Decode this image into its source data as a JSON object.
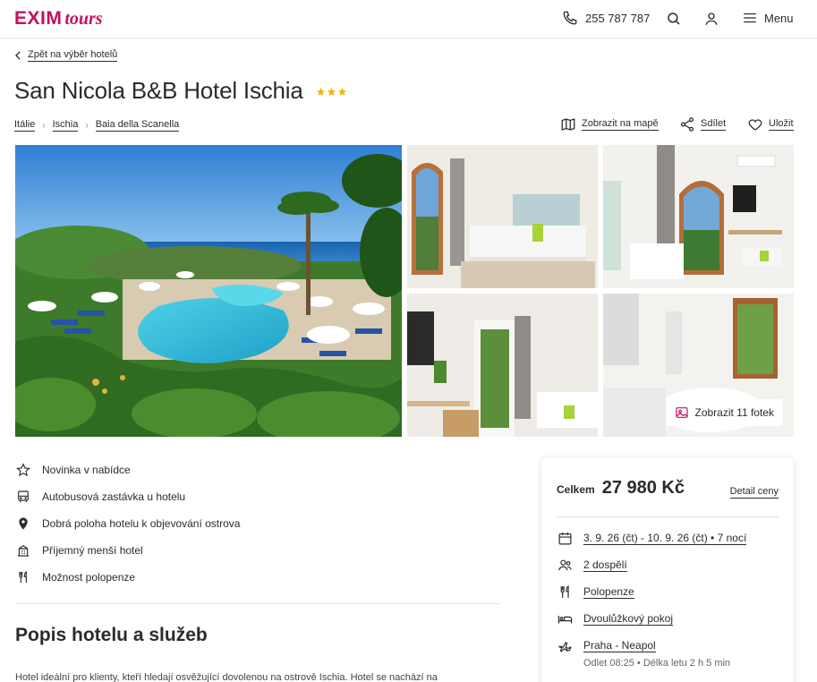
{
  "header": {
    "logo_main": "EXIM",
    "logo_italic": "tours",
    "phone": "255 787 787",
    "menu_label": "Menu"
  },
  "back_link": "Zpět na výběr hotelů",
  "hotel": {
    "name": "San Nicola B&B Hotel Ischia",
    "stars": 3
  },
  "breadcrumbs": [
    "Itálie",
    "Ischia",
    "Baia della Scanella"
  ],
  "actions": {
    "map": "Zobrazit na mapě",
    "share": "Sdílet",
    "save": "Uložit"
  },
  "gallery": {
    "more_label": "Zobrazit 11 fotek"
  },
  "features": [
    {
      "icon": "star-icon",
      "label": "Novinka v nabídce"
    },
    {
      "icon": "bus-icon",
      "label": "Autobusová zastávka u hotelu"
    },
    {
      "icon": "location-pin-icon",
      "label": "Dobrá poloha hotelu k objevování ostrova"
    },
    {
      "icon": "building-icon",
      "label": "Příjemný menší hotel"
    },
    {
      "icon": "cutlery-icon",
      "label": "Možnost polopenze"
    }
  ],
  "description": {
    "title": "Popis hotelu a služeb",
    "text": "Hotel ideální pro klienty, kteří hledají osvěžující dovolenou na ostrově Ischia. Hotel se nachází na"
  },
  "price_card": {
    "total_label": "Celkem",
    "total_price": "27 980 Kč",
    "detail_link": "Detail ceny",
    "dates": "3. 9. 26 (čt) - 10. 9. 26 (čt) • 7 nocí",
    "travelers": "2 dospělí",
    "board": "Polopenze",
    "room": "Dvoulůžkový pokoj",
    "flight": "Praha - Neapol",
    "flight_details": "Odlet 08:25 • Délka letu 2 h 5 min"
  },
  "colors": {
    "brand": "#c3105e",
    "star": "#f2b705",
    "text": "#2b2b2b"
  }
}
